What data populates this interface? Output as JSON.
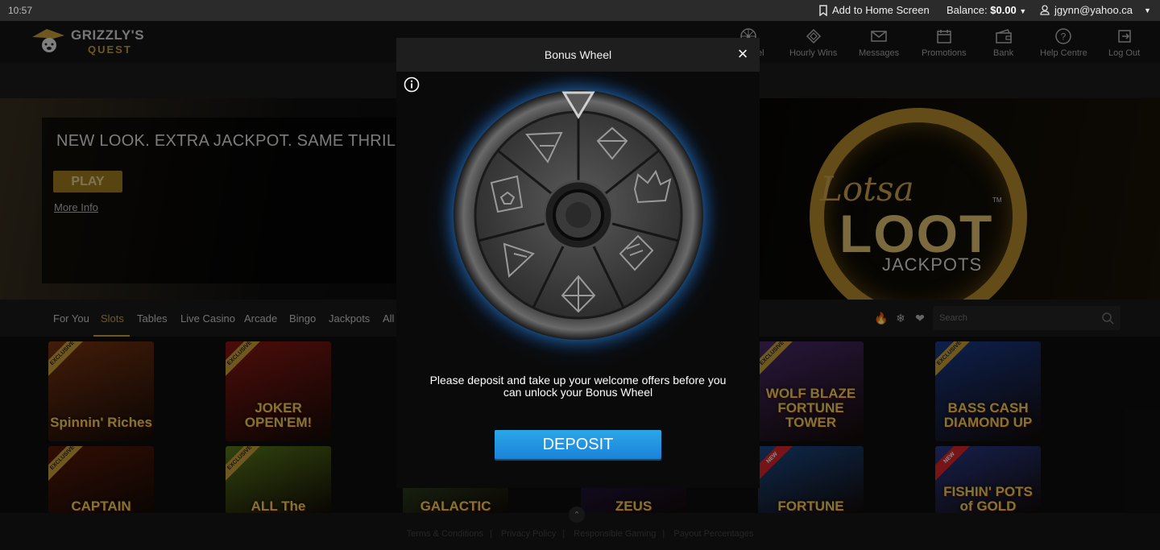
{
  "status_bar": {
    "time": "10:57",
    "add_home": "Add to Home Screen",
    "balance_label": "Balance:",
    "balance_value": "$0.00",
    "user": "jgynn@yahoo.ca"
  },
  "header": {
    "logo_top": "GRIZZLY'S",
    "logo_bottom": "QUEST",
    "nav": [
      {
        "label": "el",
        "icon": "wheel-icon"
      },
      {
        "label": "Hourly Wins",
        "icon": "diamond-ticket-icon"
      },
      {
        "label": "Messages",
        "icon": "envelope-icon"
      },
      {
        "label": "Promotions",
        "icon": "calendar-gift-icon"
      },
      {
        "label": "Bank",
        "icon": "wallet-icon"
      },
      {
        "label": "Help Centre",
        "icon": "help-icon"
      },
      {
        "label": "Log Out",
        "icon": "logout-icon"
      }
    ]
  },
  "hero": {
    "title": "NEW LOOK. EXTRA JACKPOT. SAME THRILL.",
    "play": "PLAY",
    "more_info": "More Info",
    "promo_lotsa": "Lotsa",
    "promo_loot": "LOOT",
    "promo_jackpots": "JACKPOTS",
    "promo_tm": "TM"
  },
  "categories": [
    "For You",
    "Slots",
    "Tables",
    "Live Casino",
    "Arcade",
    "Bingo",
    "Jackpots",
    "All"
  ],
  "active_category": "Slots",
  "search": {
    "placeholder": "Search"
  },
  "games": [
    {
      "name": "Spinnin' Riches",
      "badge": "EXCLUSIVE",
      "color": "#7a3410"
    },
    {
      "name": "JOKER OPEN'EM!",
      "badge": "EXCLUSIVE",
      "color": "#8a1812"
    },
    {
      "name": "WOLF BLAZE FORTUNE TOWER",
      "badge": "EXCLUSIVE",
      "color": "#4a2a6a"
    },
    {
      "name": "BASS CASH DIAMOND UP",
      "badge": "EXCLUSIVE",
      "color": "#1a3a8a"
    },
    {
      "name": "CAPTAIN",
      "badge": "EXCLUSIVE",
      "color": "#5a1a0a"
    },
    {
      "name": "ALL The",
      "badge": "EXCLUSIVE",
      "color": "#5a7a1a"
    },
    {
      "name": "GALACTIC",
      "badge": "",
      "color": "#3a5a2a"
    },
    {
      "name": "ZEUS",
      "badge": "",
      "color": "#2a1a5a"
    },
    {
      "name": "FORTUNE",
      "badge": "NEW",
      "color": "#1a4a8a"
    },
    {
      "name": "FISHIN' POTS of GOLD",
      "badge": "NEW",
      "color": "#2a3a8a"
    }
  ],
  "footer": {
    "links": [
      "Terms & Conditions",
      "Privacy Policy",
      "Responsible Gaming",
      "Payout Percentages"
    ]
  },
  "modal": {
    "title": "Bonus Wheel",
    "close": "×",
    "message": "Please deposit and take up your welcome offers before you can unlock your Bonus Wheel",
    "deposit": "DEPOSIT"
  }
}
